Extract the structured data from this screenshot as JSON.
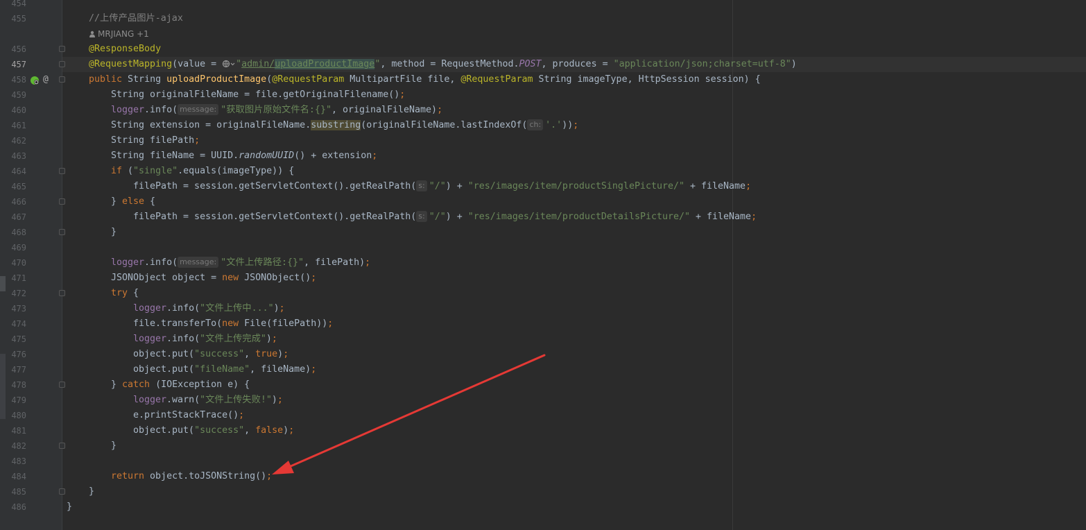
{
  "editor": {
    "author_annotation": "MRJIANG +1",
    "colors": {
      "background": "#2b2b2b",
      "keyword": "#cc7832",
      "annotation": "#bbb529",
      "string": "#6a8759",
      "comment": "#808080",
      "method_decl": "#ffc66d",
      "field": "#9876aa",
      "arrow": "#e53935"
    },
    "lines": {
      "l454": {
        "num": "454"
      },
      "l455": {
        "num": "455",
        "comment": "//上传产品图片-ajax"
      },
      "l456": {
        "num": "456",
        "t1": "@ResponseBody"
      },
      "l457": {
        "num": "457",
        "t1": "@RequestMapping",
        "t2": "(value = ",
        "t3": "\"",
        "t4": "admin/",
        "t5": "uploadProductImage",
        "t6": "\"",
        "t7": ", method = RequestMethod.",
        "t8": "POST",
        "t9": ", produces = ",
        "t10": "\"application/json;charset=utf-8\"",
        "t11": ")"
      },
      "l458": {
        "num": "458",
        "t1": "public ",
        "t2": "String ",
        "t3": "uploadProductImage",
        "t4": "(",
        "t5": "@RequestParam ",
        "t6": "MultipartFile file, ",
        "t7": "@RequestParam ",
        "t8": "String imageType, HttpSession session) {"
      },
      "l459": {
        "num": "459",
        "t1": "String originalFileName = file.getOriginalFilename()",
        "t2": ";"
      },
      "l460": {
        "num": "460",
        "t1": "logger",
        "t2": ".info(",
        "hint": "message:",
        "t3": "\"获取图片原始文件名:{}\"",
        "t4": ", originalFileName)",
        "t5": ";"
      },
      "l461": {
        "num": "461",
        "t1": "String extension = originalFileName.",
        "t2": "substring",
        "t3": "(originalFileName.lastIndexOf(",
        "hint": "ch:",
        "t4": "'.'",
        "t5": "))",
        "t6": ";"
      },
      "l462": {
        "num": "462",
        "t1": "String filePath",
        "t2": ";"
      },
      "l463": {
        "num": "463",
        "t1": "String fileName = UUID.",
        "t2": "randomUUID",
        "t3": "() + extension",
        "t4": ";"
      },
      "l464": {
        "num": "464",
        "t1": "if ",
        "t2": "(",
        "t3": "\"single\"",
        "t4": ".equals(imageType)) {"
      },
      "l465": {
        "num": "465",
        "t1": "filePath = session.getServletContext().getRealPath(",
        "hint": "s:",
        "t2": "\"/\"",
        "t3": ") + ",
        "t4": "\"res/images/item/productSinglePicture/\"",
        "t5": " + fileName",
        "t6": ";"
      },
      "l466": {
        "num": "466",
        "t1": "} ",
        "t2": "else ",
        "t3": "{"
      },
      "l467": {
        "num": "467",
        "t1": "filePath = session.getServletContext().getRealPath(",
        "hint": "s:",
        "t2": "\"/\"",
        "t3": ") + ",
        "t4": "\"res/images/item/productDetailsPicture/\"",
        "t5": " + fileName",
        "t6": ";"
      },
      "l468": {
        "num": "468",
        "t1": "}"
      },
      "l469": {
        "num": "469"
      },
      "l470": {
        "num": "470",
        "t1": "logger",
        "t2": ".info(",
        "hint": "message:",
        "t3": "\"文件上传路径:{}\"",
        "t4": ", filePath)",
        "t5": ";"
      },
      "l471": {
        "num": "471",
        "t1": "JSONObject object = ",
        "t2": "new ",
        "t3": "JSONObject()",
        "t4": ";"
      },
      "l472": {
        "num": "472",
        "t1": "try ",
        "t2": "{"
      },
      "l473": {
        "num": "473",
        "t1": "logger",
        "t2": ".info(",
        "t3": "\"文件上传中...\"",
        "t4": ")",
        "t5": ";"
      },
      "l474": {
        "num": "474",
        "t1": "file.transferTo(",
        "t2": "new ",
        "t3": "File(filePath))",
        "t4": ";"
      },
      "l475": {
        "num": "475",
        "t1": "logger",
        "t2": ".info(",
        "t3": "\"文件上传完成\"",
        "t4": ")",
        "t5": ";"
      },
      "l476": {
        "num": "476",
        "t1": "object.put(",
        "t2": "\"success\"",
        "t3": ", ",
        "t4": "true",
        "t5": ")",
        "t6": ";"
      },
      "l477": {
        "num": "477",
        "t1": "object.put(",
        "t2": "\"fileName\"",
        "t3": ", fileName)",
        "t4": ";"
      },
      "l478": {
        "num": "478",
        "t1": "} ",
        "t2": "catch ",
        "t3": "(IOException e) {"
      },
      "l479": {
        "num": "479",
        "t1": "logger",
        "t2": ".warn(",
        "t3": "\"文件上传失败!\"",
        "t4": ")",
        "t5": ";"
      },
      "l480": {
        "num": "480",
        "t1": "e.printStackTrace()",
        "t2": ";"
      },
      "l481": {
        "num": "481",
        "t1": "object.put(",
        "t2": "\"success\"",
        "t3": ", ",
        "t4": "false",
        "t5": ")",
        "t6": ";"
      },
      "l482": {
        "num": "482",
        "t1": "}"
      },
      "l483": {
        "num": "483"
      },
      "l484": {
        "num": "484",
        "t1": "return ",
        "t2": "object.toJSONString()",
        "t3": ";"
      },
      "l485": {
        "num": "485",
        "t1": "}"
      },
      "l486": {
        "num": "486",
        "t1": "}"
      }
    }
  }
}
